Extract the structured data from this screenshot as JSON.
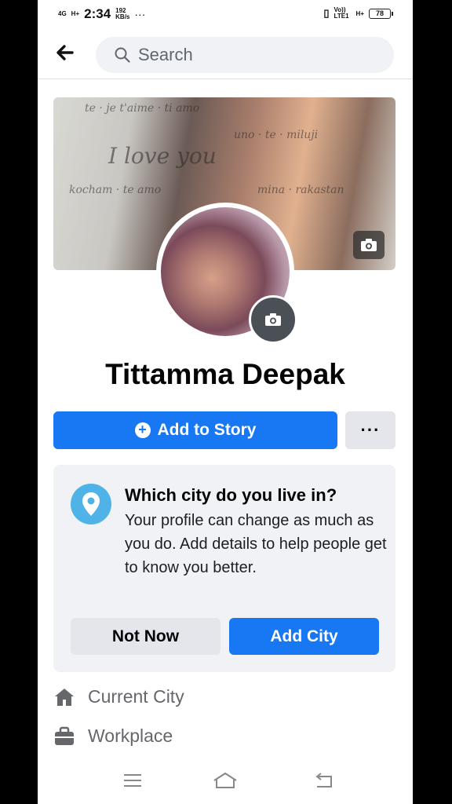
{
  "status_bar": {
    "network_left": "4G",
    "signal_hplus": "H+",
    "time": "2:34",
    "speed_value": "192",
    "speed_unit": "KB/s",
    "more": "···",
    "volte": "Vo)) LTE1",
    "hplus_right": "H+",
    "battery": "78"
  },
  "header": {
    "search_placeholder": "Search"
  },
  "profile": {
    "name": "Tittamma Deepak"
  },
  "actions": {
    "add_story_label": "Add to Story",
    "more_label": "···"
  },
  "city_prompt": {
    "question": "Which city do you live in?",
    "description": "Your profile can change as much as you do. Add details to help people get to know you better.",
    "not_now_label": "Not Now",
    "add_city_label": "Add City"
  },
  "details": [
    {
      "label": "Current City",
      "icon": "home-icon"
    },
    {
      "label": "Workplace",
      "icon": "briefcase-icon"
    }
  ],
  "colors": {
    "primary": "#1877f2",
    "secondary_button": "#e4e6eb",
    "card_bg": "#f0f2f5",
    "location_icon": "#4fb3e8"
  }
}
